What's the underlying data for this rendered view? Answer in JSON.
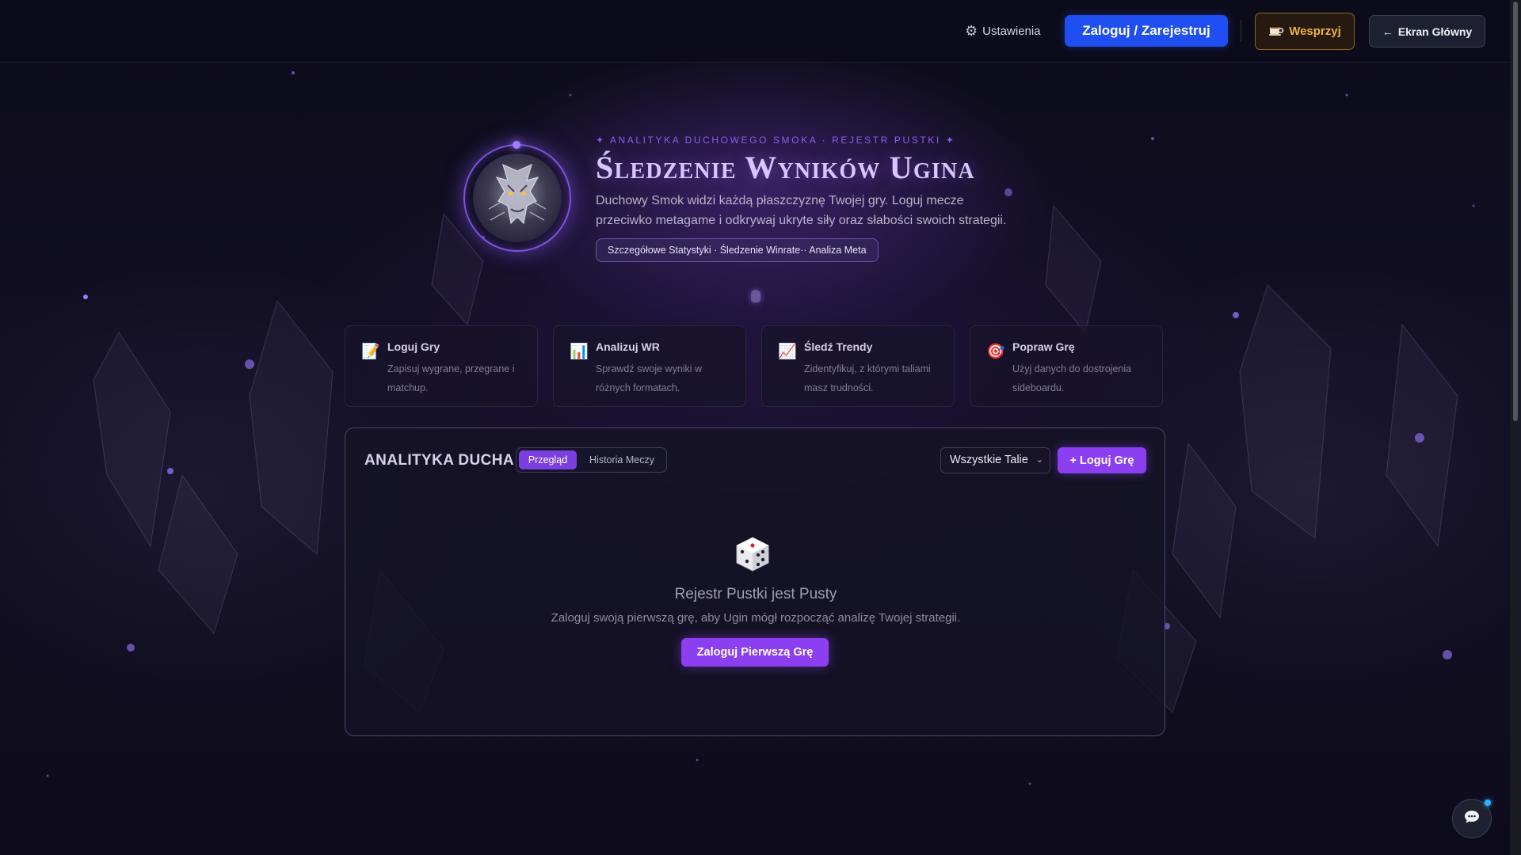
{
  "topbar": {
    "settings_label": "Ustawienia",
    "login_label": "Zaloguj / Zarejestruj",
    "support_label": "Wesprzyj",
    "home_label": "Ekran Główny",
    "home_arrow": "←"
  },
  "hero": {
    "eyebrow": "✦ ANALITYKA DUCHOWEGO SMOKA · REJESTR PUSTKI ✦",
    "title": "Śledzenie Wyników Ugina",
    "description": "Duchowy Smok widzi każdą płaszczyznę Twojej gry. Loguj mecze przeciwko metagame i odkrywaj ukryte siły oraz słabości swoich strategii.",
    "pill": "Szczegółowe Statystyki · Śledzenie Winrate·· Analiza Meta"
  },
  "features": [
    {
      "icon": "📝",
      "title": "Loguj Gry",
      "desc": "Zapisuj wygrane, przegrane i matchup."
    },
    {
      "icon": "📊",
      "title": "Analizuj WR",
      "desc": "Sprawdź swoje wyniki w różnych formatach."
    },
    {
      "icon": "📈",
      "title": "Śledź Trendy",
      "desc": "Zidentyfikuj, z którymi taliami masz trudności."
    },
    {
      "icon": "🎯",
      "title": "Popraw Grę",
      "desc": "Użyj danych do dostrojenia sideboardu."
    }
  ],
  "panel": {
    "title": "ANALITYKA DUCHA",
    "tabs": [
      {
        "label": "Przegląd",
        "active": true
      },
      {
        "label": "Historia Meczy",
        "active": false
      }
    ],
    "deck_filter": "Wszystkie Talie",
    "log_button": "+ Loguj Grę",
    "empty": {
      "title": "Rejestr Pustki jest Pusty",
      "description": "Zaloguj swoją pierwszą grę, aby Ugin mógł rozpocząć analizę Twojej strategii.",
      "button": "Zaloguj Pierwszą Grę"
    }
  },
  "colors": {
    "accent_purple": "#8b3ff0",
    "login_blue": "#1f4ff0",
    "support_gold": "#f0b140",
    "title_lavender": "#d7c6ff"
  },
  "icons": {
    "settings": "gear-icon",
    "support": "coffee-icon",
    "dragon_avatar": "spirit-dragon-icon",
    "empty_state": "dice-icon",
    "chat": "chat-icon"
  }
}
